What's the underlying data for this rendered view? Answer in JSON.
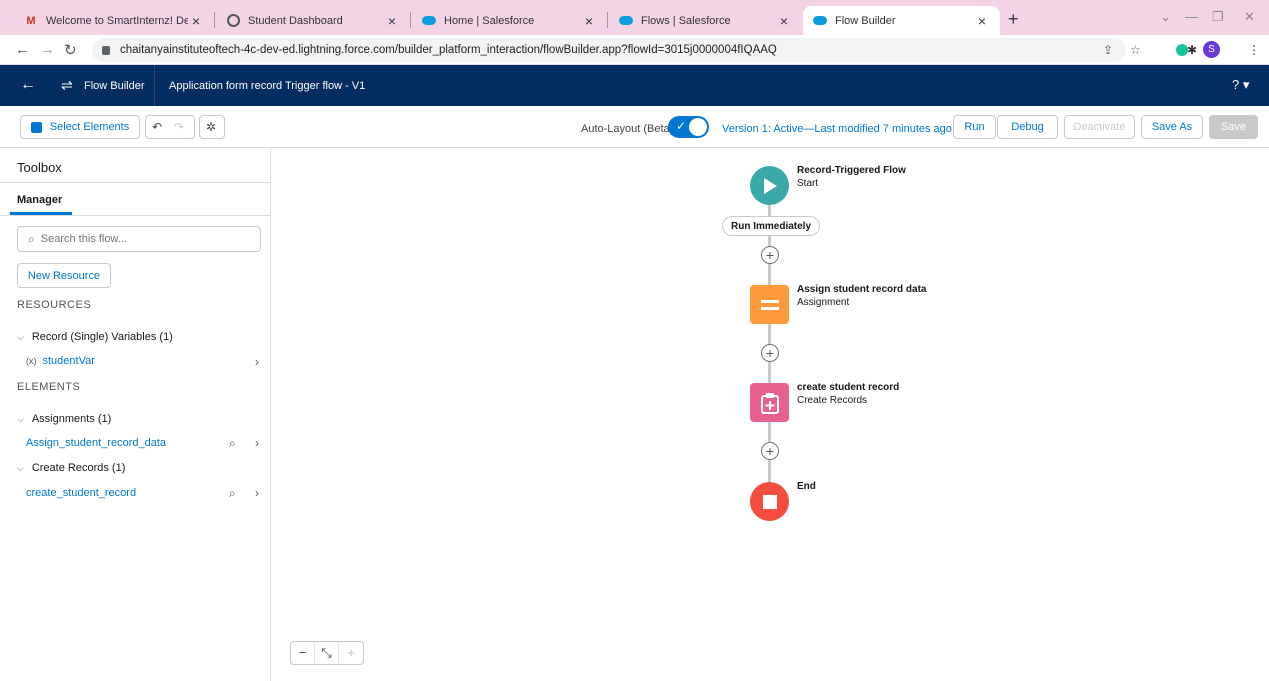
{
  "browser": {
    "tabs": [
      {
        "title": "Welcome to SmartInternz! Deligh",
        "icon": "gmail-icon"
      },
      {
        "title": "Student Dashboard",
        "icon": "globe-icon"
      },
      {
        "title": "Home | Salesforce",
        "icon": "salesforce-icon"
      },
      {
        "title": "Flows | Salesforce",
        "icon": "salesforce-icon"
      },
      {
        "title": "Flow Builder",
        "icon": "salesforce-icon",
        "active": true
      }
    ],
    "url": "chaitanyainstituteoftech-4c-dev-ed.lightning.force.com/builder_platform_interaction/flowBuilder.app?flowId=3015j0000004fIQAAQ",
    "profile_initial": "S"
  },
  "header": {
    "app_name": "Flow Builder",
    "flow_name": "Application form record Trigger flow - V1",
    "help": "?"
  },
  "toolbar": {
    "select_elements": "Select Elements",
    "auto_layout_label": "Auto-Layout (Beta)",
    "auto_layout_on": true,
    "version_status": "Version 1: Active—Last modified 7 minutes ago",
    "run": "Run",
    "debug": "Debug",
    "deactivate": "Deactivate",
    "save_as": "Save As",
    "save": "Save"
  },
  "sidebar": {
    "title": "Toolbox",
    "tab": "Manager",
    "search_placeholder": "Search this flow...",
    "new_resource": "New Resource",
    "resources_header": "RESOURCES",
    "record_vars_group": "Record (Single) Variables (1)",
    "student_var": "studentVar",
    "elements_header": "ELEMENTS",
    "assignments_group": "Assignments (1)",
    "assignment_item": "Assign_student_record_data",
    "create_records_group": "Create Records (1)",
    "create_item": "create_student_record"
  },
  "canvas": {
    "start_title": "Record-Triggered Flow",
    "start_sub": "Start",
    "run_immediately": "Run Immediately",
    "assign_title": "Assign student record data",
    "assign_sub": "Assignment",
    "create_title": "create student record",
    "create_sub": "Create Records",
    "end_title": "End",
    "colors": {
      "start": "#3ba9a9",
      "assignment": "#ff9a3c",
      "create": "#e8618c",
      "end": "#f24d3d"
    }
  }
}
